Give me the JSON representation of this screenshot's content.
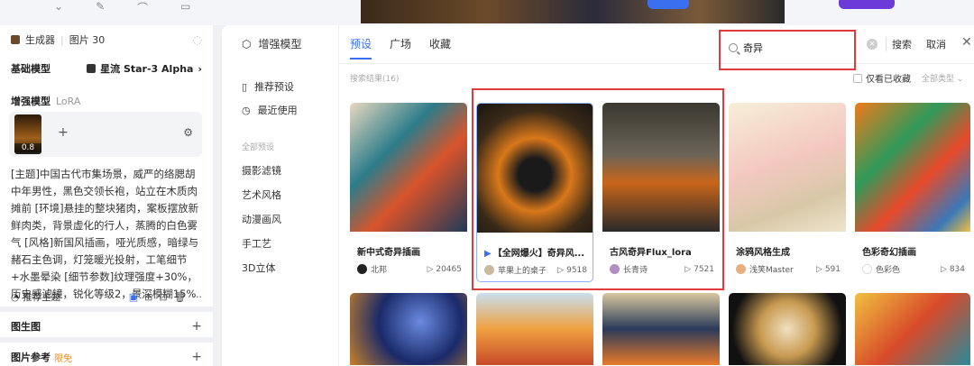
{
  "colors": {
    "accent": "#3a6ff0",
    "highlight": "#e23a3a"
  },
  "left_panel": {
    "generator_label": "生成器",
    "image_count_label": "图片 30",
    "base_model_label": "基础模型",
    "base_model_value": "星流 Star-3 Alpha",
    "enhance_model_label": "增强模型",
    "enhance_model_sub": "LoRA",
    "lora_weight": "0.8",
    "prompt_text": "[主题]中国古代市集场景，威严的络腮胡中年男性，黑色交领长袍，站立在木质肉摊前 [环境]悬挂的整块猪肉，案板摆放新鲜肉类，背景虚化的行人，蒸腾的白色雾气 [风格]新国风插画，哑光质感，暗绿与赭石主色调，灯笼暖光投射，工笔细节+水墨晕染 [细节参数]纹理强度+30%，历史感滤镜，锐化等级2，景深模糊15%",
    "recommend_theme_label": "推荐主题",
    "image_gen_label": "图生图",
    "image_ref_label": "图片参考",
    "free_label": "限免"
  },
  "dialog": {
    "title": "增强模型",
    "tabs": [
      "预设",
      "广场",
      "收藏"
    ],
    "sidebar": {
      "items": [
        "推荐预设",
        "最近使用"
      ],
      "section_label": "全部预设",
      "categories": [
        "摄影滤镜",
        "艺术风格",
        "动漫画风",
        "手工艺",
        "3D立体"
      ]
    },
    "search": {
      "value": "奇异",
      "search_button": "搜索",
      "cancel_button": "取消"
    },
    "result_count": "搜索结果(16)",
    "only_favorites_label": "仅看已收藏",
    "all_types_label": "全部类型"
  },
  "cards": [
    {
      "title": "新中式奇异插画",
      "author": "北邦",
      "count": "20465"
    },
    {
      "title": "【全网爆火】奇异风...",
      "author": "苹果上的桌子",
      "count": "9518"
    },
    {
      "title": "古风奇异Flux_lora",
      "author": "长青诗",
      "count": "7521"
    },
    {
      "title": "涂鸦风格生成",
      "author": "浅笑Master",
      "count": "591"
    },
    {
      "title": "色彩奇幻插画",
      "author": "色彩色",
      "count": "834"
    }
  ]
}
